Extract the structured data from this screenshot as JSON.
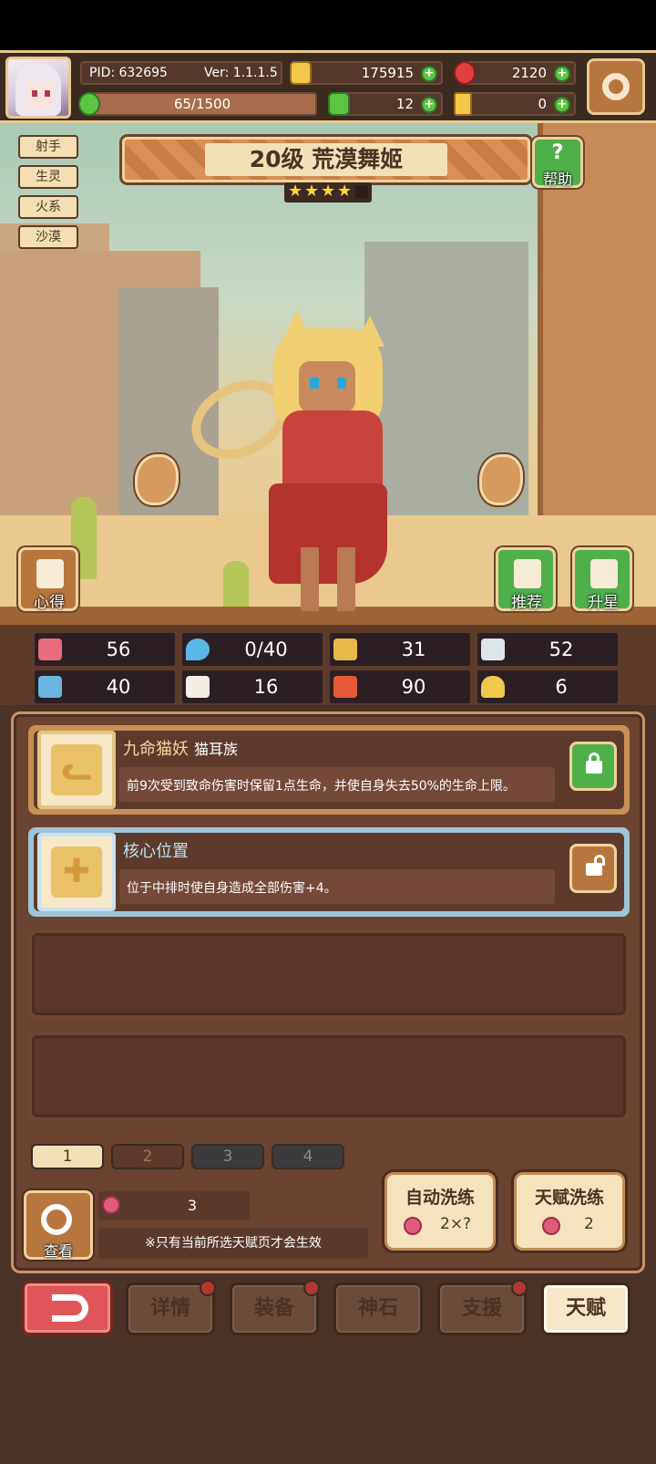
{
  "header": {
    "pid": "PID: 632695",
    "version": "Ver: 1.1.1.5",
    "gold": "175915",
    "gems": "2120",
    "stamina": "65/1500",
    "clover": "12",
    "keys": "0"
  },
  "hero": {
    "title": "20级  荒漠舞姬",
    "stars_filled": 4,
    "stars_total": 5,
    "help_label": "帮助",
    "tags": [
      "射手",
      "生灵",
      "火系",
      "沙漠"
    ],
    "notes_label": "心得",
    "recommend_label": "推荐",
    "star_up_label": "升星"
  },
  "stats": [
    {
      "icon": "heart-icon",
      "value": "56"
    },
    {
      "icon": "water-drop-icon",
      "value": "0/40"
    },
    {
      "icon": "shield-icon",
      "value": "31"
    },
    {
      "icon": "wing-icon",
      "value": "52"
    },
    {
      "icon": "fist-icon",
      "value": "40"
    },
    {
      "icon": "book-icon",
      "value": "16"
    },
    {
      "icon": "card-icon",
      "value": "90"
    },
    {
      "icon": "horseshoe-icon",
      "value": "6"
    }
  ],
  "talents": [
    {
      "name": "九命猫妖",
      "tag": "猫耳族",
      "desc": "前9次受到致命伤害时保留1点生命，并使自身失去50%的生命上限。",
      "locked": true,
      "icon": "cat-face-icon"
    },
    {
      "name": "核心位置",
      "tag": "",
      "desc": "位于中排时使自身造成全部伤害+4。",
      "locked": false,
      "icon": "cross-icon"
    }
  ],
  "pages": [
    "1",
    "2",
    "3",
    "4"
  ],
  "bottom": {
    "view_label": "查看",
    "cost": "3",
    "note": "※只有当前所选天赋页才会生效",
    "auto_reroll": "自动洗练",
    "auto_cost": "2×?",
    "talent_reroll": "天赋洗练",
    "talent_cost": "2"
  },
  "nav": {
    "details": "详情",
    "equipment": "装备",
    "god_stone": "神石",
    "support": "支援",
    "talent": "天赋"
  },
  "colors": {
    "panel": "#6a4331",
    "gold_border": "#e8c98f",
    "green": "#4fb04a",
    "red": "#e05658"
  }
}
